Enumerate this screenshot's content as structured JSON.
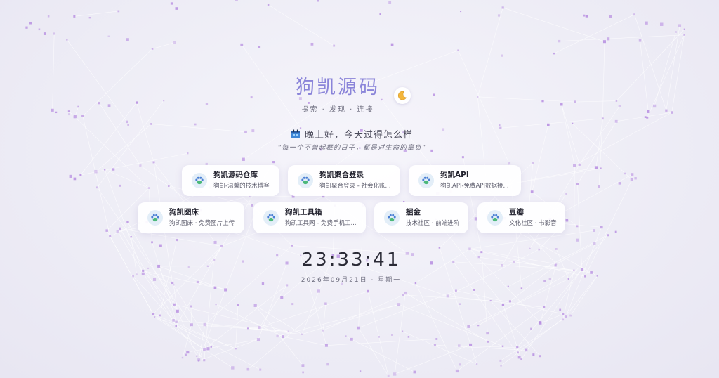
{
  "header": {
    "title": "狗凯源码",
    "subtitle": "探索 · 发现 · 连接",
    "theme_toggle_icon": "crescent-moon-icon"
  },
  "greeting": {
    "text": "晚上好，今天过得怎么样",
    "icon": "calendar-icon",
    "quote": "“每一个不曾起舞的日子，都是对生命的辜负”"
  },
  "links": [
    {
      "title": "狗凯源码仓库",
      "desc": "狗凯-温馨的技术博客"
    },
    {
      "title": "狗凯聚合登录",
      "desc": "狗凯聚合登录 - 社会化账..."
    },
    {
      "title": "狗凯API",
      "desc": "狗凯API-免费API数据接..."
    },
    {
      "title": "狗凯图床",
      "desc": "狗凯图床 · 免费图片上传"
    },
    {
      "title": "狗凯工具箱",
      "desc": "狗凯工具网 - 免费手机工..."
    },
    {
      "title": "掘金",
      "desc": "技术社区 · 前端进阶"
    },
    {
      "title": "豆瓣",
      "desc": "文化社区 · 书影音"
    }
  ],
  "clock": {
    "time": "23:33:41",
    "date": "2026年09月21日 · 星期一"
  },
  "colors": {
    "title": "#8a84d9",
    "particle": "#b58ae0",
    "card_bg": "#ffffff",
    "paw_green": "#4bb87a",
    "paw_blue": "#4a7fd4"
  }
}
